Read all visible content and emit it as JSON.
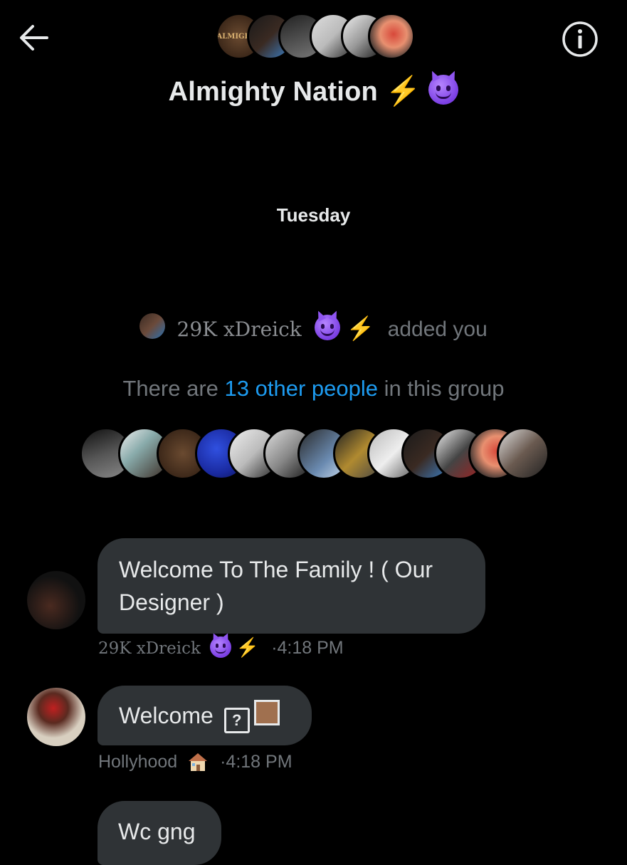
{
  "header": {
    "back_icon": "arrow-left-icon",
    "info_icon": "info-circle-icon",
    "title": "Almighty Nation",
    "title_emojis": [
      "lightning-bolt-emoji",
      "smiling-devil-emoji"
    ],
    "header_avatar_logo_text": "ALMIGHTY"
  },
  "timeline": {
    "date_label": "Tuesday",
    "added_notice": {
      "actor": "29K xDreick",
      "actor_emojis": [
        "smiling-devil-emoji",
        "lightning-bolt-emoji"
      ],
      "action": "added you"
    },
    "others_notice": {
      "prefix": "There are",
      "link": "13 other people",
      "suffix": "in this group"
    }
  },
  "messages": [
    {
      "text": "Welcome To The Family ! ( Our Designer )",
      "sender": "29K xDreick",
      "sender_emojis": [
        "smiling-devil-emoji",
        "lightning-bolt-emoji"
      ],
      "time": "4:18 PM"
    },
    {
      "text": "Welcome",
      "trailing_glyphs": [
        "?"
      ],
      "sender": "Hollyhood",
      "sender_emojis": [
        "house-emoji"
      ],
      "time": "4:18 PM"
    },
    {
      "text": "Wc gng"
    }
  ],
  "colors": {
    "background": "#000000",
    "bubble": "#2f3336",
    "text_primary": "#e7e9ea",
    "text_secondary": "#71767b",
    "link": "#1d9bf0",
    "bolt": "#ffc21a",
    "devil": "#8f55f0"
  }
}
